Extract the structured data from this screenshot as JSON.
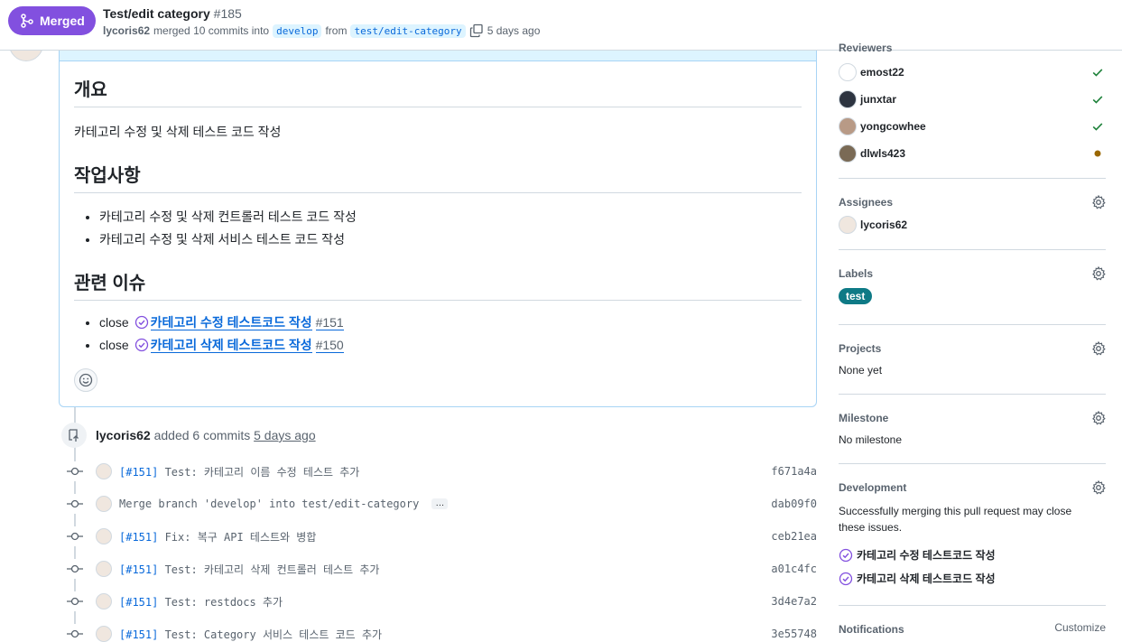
{
  "header": {
    "status_label": "Merged",
    "title": "Test/edit category",
    "number": "#185",
    "author": "lycoris62",
    "merge_text": "merged 10 commits into",
    "base_branch": "develop",
    "from_text": "from",
    "head_branch": "test/edit-category",
    "time": "5 days ago"
  },
  "description": {
    "heading_overview": "개요",
    "overview_text": "카테고리 수정 및 삭제 테스트 코드 작성",
    "heading_work": "작업사항",
    "work_items": [
      "카테고리 수정 및 삭제 컨트롤러 테스트 코드 작성",
      "카테고리 수정 및 삭제 서비스 테스트 코드 작성"
    ],
    "heading_issues": "관련 이슈",
    "issues": [
      {
        "prefix": "close",
        "title": "카테고리 수정 테스트코드 작성",
        "number": "#151"
      },
      {
        "prefix": "close",
        "title": "카테고리 삭제 테스트코드 작성",
        "number": "#150"
      }
    ]
  },
  "timeline": {
    "event_author": "lycoris62",
    "event_text": "added 6 commits",
    "event_time": "5 days ago",
    "commits": [
      {
        "ref": "[#151]",
        "message": " Test: 카테고리 이름 수정 테스트 추가",
        "sha": "f671a4a"
      },
      {
        "ref": "",
        "message": "Merge branch 'develop' into test/edit-category",
        "sha": "dab09f0",
        "ellipsis": "…"
      },
      {
        "ref": "[#151]",
        "message": " Fix: 복구 API 테스트와 병합",
        "sha": "ceb21ea"
      },
      {
        "ref": "[#151]",
        "message": " Test: 카테고리 삭제 컨트롤러 테스트 추가",
        "sha": "a01c4fc"
      },
      {
        "ref": "[#151]",
        "message": " Test: restdocs 추가",
        "sha": "3d4e7a2"
      },
      {
        "ref": "[#151]",
        "message": " Test: Category 서비스 테스트 코드 추가",
        "sha": "3e55748"
      }
    ]
  },
  "sidebar": {
    "reviewers_title": "Reviewers",
    "reviewers": [
      {
        "name": "emost22",
        "status": "approved"
      },
      {
        "name": "junxtar",
        "status": "approved"
      },
      {
        "name": "yongcowhee",
        "status": "approved"
      },
      {
        "name": "dlwls423",
        "status": "pending"
      }
    ],
    "assignees_title": "Assignees",
    "assignee": "lycoris62",
    "labels_title": "Labels",
    "label": "test",
    "label_color": "#0e7a86",
    "projects_title": "Projects",
    "projects_value": "None yet",
    "milestone_title": "Milestone",
    "milestone_value": "No milestone",
    "development_title": "Development",
    "development_text": "Successfully merging this pull request may close these issues.",
    "dev_issues": [
      "카테고리 수정 테스트코드 작성",
      "카테고리 삭제 테스트코드 작성"
    ],
    "notifications_title": "Notifications",
    "customize_label": "Customize"
  },
  "colors": {
    "merged": "#8250df",
    "link": "#0969da",
    "approved": "#1a7f37",
    "pending": "#9a6700"
  }
}
